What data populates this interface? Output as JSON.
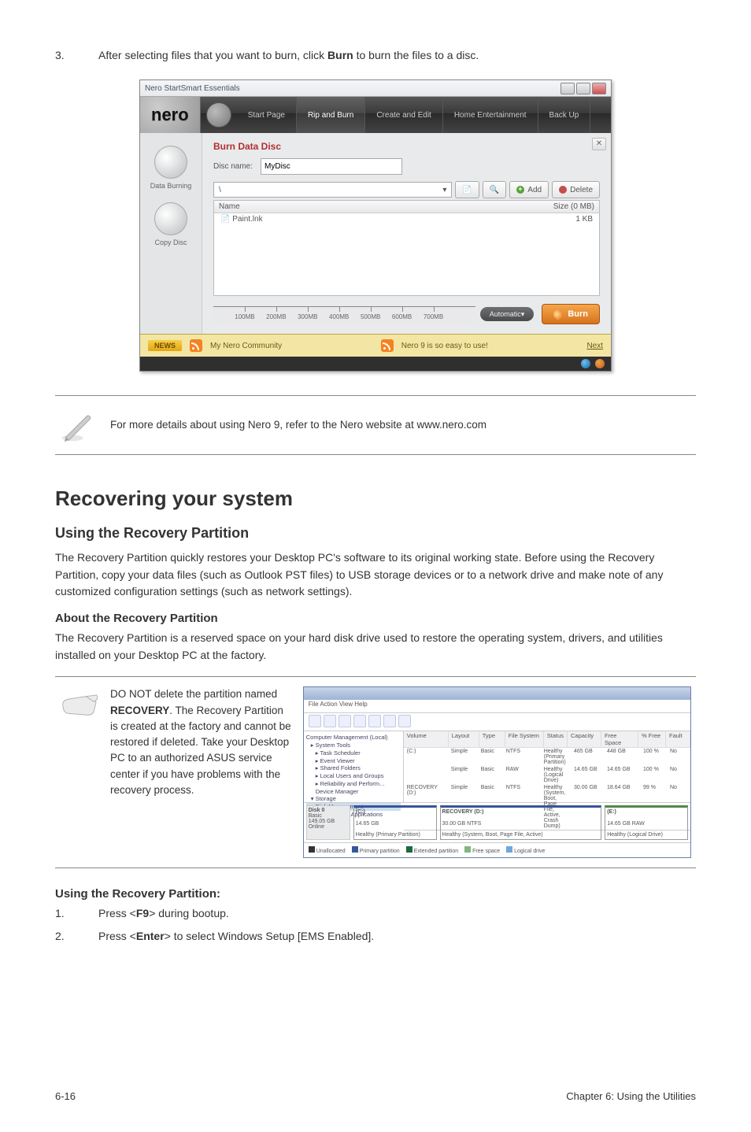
{
  "step3": {
    "num": "3.",
    "text_before": "After selecting files that you want to burn, click ",
    "bold": "Burn",
    "text_after": " to burn the files to a disc."
  },
  "nero": {
    "window_title": "Nero StartSmart Essentials",
    "logo": "nero",
    "tabs": [
      "Start Page",
      "Rip and Burn",
      "Create and Edit",
      "Home Entertainment",
      "Back Up"
    ],
    "side": [
      "Data Burning",
      "Copy Disc"
    ],
    "panel_title": "Burn Data Disc",
    "disc_label": "Disc name:",
    "disc_value": "MyDisc",
    "path_value": "\\",
    "add_btn": "Add",
    "delete_btn": "Delete",
    "col_name": "Name",
    "col_size": "Size (0 MB)",
    "file1": "Paint.lnk",
    "file1_size": "1 KB",
    "ticks": [
      "100MB",
      "200MB",
      "300MB",
      "400MB",
      "500MB",
      "600MB",
      "700MB"
    ],
    "auto": "Automatic",
    "burn": "Burn",
    "news": "NEWS",
    "community": "My Nero Community",
    "easy": "Nero 9 is so easy to use!",
    "next": "Next"
  },
  "note1": "For more details about using Nero 9, refer to the Nero website at www.nero.com",
  "h1": "Recovering your system",
  "h2": "Using the Recovery Partition",
  "p1": "The Recovery Partition quickly restores your Desktop PC's software to its original working state. Before using the Recovery Partition, copy your data files (such as Outlook PST files) to USB storage devices or to a network drive and make note of any customized configuration settings (such as network settings).",
  "sub1": "About the Recovery Partition",
  "p2": "The Recovery Partition is a reserved space on your hard disk drive used to restore the operating system, drivers, and utilities installed on your Desktop PC at the factory.",
  "hand_note_l1": "DO NOT delete the partition named ",
  "hand_note_bold": "RECOVERY",
  "hand_note_l2": ". The Recovery Partition is created at the factory and cannot be restored if deleted. Take your Desktop PC to an authorized ASUS service center if you have problems with the recovery process.",
  "dm": {
    "menu": "File   Action   View   Help",
    "tree": [
      "Computer Management (Local)",
      "System Tools",
      "Task Scheduler",
      "Event Viewer",
      "Shared Folders",
      "Local Users and Groups",
      "Reliability and Perform...",
      "Device Manager",
      "Storage",
      "Disk Management",
      "Services and Applications"
    ],
    "cols": [
      "Volume",
      "Layout",
      "Type",
      "File System",
      "Status",
      "Capacity",
      "Free Space",
      "% Free",
      "Fault"
    ],
    "rows": [
      [
        "(C:)",
        "Simple",
        "Basic",
        "NTFS",
        "Healthy (Primary Partition)",
        "465 GB",
        "448 GB",
        "100 %",
        "No"
      ],
      [
        "",
        "Simple",
        "Basic",
        "RAW",
        "Healthy (Logical Drive)",
        "14.65 GB",
        "14.65 GB",
        "100 %",
        "No"
      ],
      [
        "RECOVERY (D:)",
        "Simple",
        "Basic",
        "NTFS",
        "Healthy (System, Boot, Page File, Active, Crash Dump)",
        "30.00 GB",
        "18.64 GB",
        "99 %",
        "No"
      ]
    ],
    "disk0": [
      "Disk 0",
      "Basic",
      "149.05 GB",
      "Online"
    ],
    "p1": [
      "(C:)",
      "14.65 GB",
      "Healthy (Primary Partition)"
    ],
    "p2": [
      "RECOVERY (D:)",
      "30.00 GB NTFS",
      "Healthy (System, Boot, Page File, Active)"
    ],
    "p3": [
      "(E:)",
      "14.65 GB RAW",
      "Healthy (Logical Drive)"
    ],
    "legend": [
      "Unallocated",
      "Primary partition",
      "Extended partition",
      "Free space",
      "Logical drive"
    ]
  },
  "sub2": "Using the Recovery Partition:",
  "step_r1": {
    "num": "1.",
    "before": "Press <",
    "key": "F9",
    "after": "> during bootup."
  },
  "step_r2": {
    "num": "2.",
    "before": "Press <",
    "key": "Enter",
    "after": "> to select Windows Setup [EMS Enabled]."
  },
  "footer_left": "6-16",
  "footer_right": "Chapter 6: Using the Utilities"
}
